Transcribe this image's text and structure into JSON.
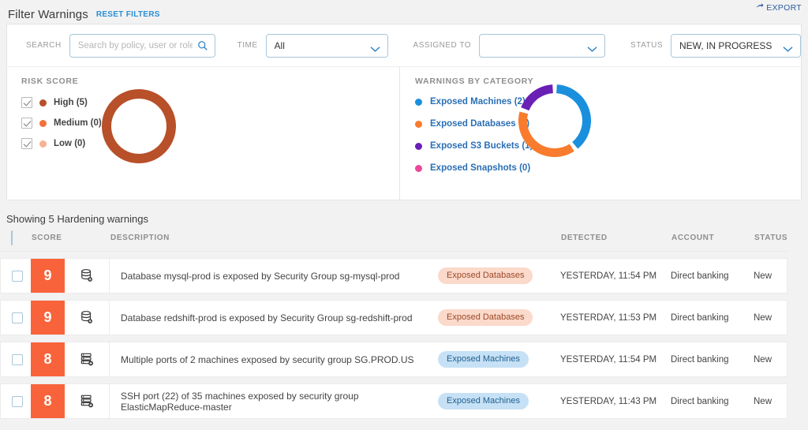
{
  "header": {
    "title": "Filter Warnings",
    "reset_label": "RESET FILTERS",
    "export_label": "EXPORT",
    "export_icon": "share-arrow-icon",
    "accent_link": "#2a8fd4"
  },
  "filters": {
    "search": {
      "label": "SEARCH",
      "placeholder": "Search by policy, user or role",
      "value": "",
      "icon": "search-icon"
    },
    "time": {
      "label": "TIME",
      "value": "All"
    },
    "assigned_to": {
      "label": "ASSIGNED TO",
      "value": ""
    },
    "status": {
      "label": "STATUS",
      "value": "NEW, IN PROGRESS"
    }
  },
  "risk_score": {
    "title": "RISK SCORE",
    "items": [
      {
        "label": "High (5)",
        "checked": true,
        "color": "#b8502a"
      },
      {
        "label": "Medium (0)",
        "checked": true,
        "color": "#f2703c"
      },
      {
        "label": "Low (0)",
        "checked": true,
        "color": "#f8b193"
      }
    ]
  },
  "warnings_by_category": {
    "title": "WARNINGS BY CATEGORY",
    "items": [
      {
        "label": "Exposed Machines (2)",
        "color": "#1a8fdd",
        "value": 2
      },
      {
        "label": "Exposed Databases (2)",
        "color": "#f97b2d",
        "value": 2
      },
      {
        "label": "Exposed S3 Buckets (1)",
        "color": "#6a1fb5",
        "value": 1
      },
      {
        "label": "Exposed Snapshots (0)",
        "color": "#ec4899",
        "value": 0
      }
    ]
  },
  "chart_data": [
    {
      "type": "pie",
      "title": "RISK SCORE",
      "categories": [
        "High",
        "Medium",
        "Low"
      ],
      "values": [
        5,
        0,
        0
      ],
      "colors": [
        "#b8502a",
        "#f2703c",
        "#f8b193"
      ],
      "legend": "left",
      "donut": true
    },
    {
      "type": "pie",
      "title": "WARNINGS BY CATEGORY",
      "categories": [
        "Exposed Machines",
        "Exposed Databases",
        "Exposed S3 Buckets",
        "Exposed Snapshots"
      ],
      "values": [
        2,
        2,
        1,
        0
      ],
      "colors": [
        "#1a8fdd",
        "#f97b2d",
        "#6a1fb5",
        "#ec4899"
      ],
      "legend": "left",
      "donut": true
    }
  ],
  "table": {
    "showing": "Showing 5 Hardening warnings",
    "columns": {
      "score": "SCORE",
      "description": "DESCRIPTION",
      "detected": "DETECTED",
      "account": "ACCOUNT",
      "status": "STATUS"
    },
    "rows": [
      {
        "score": "9",
        "icon": "database-icon",
        "description": "Database mysql-prod is exposed by Security Group sg-mysql-prod",
        "tag": "Exposed Databases",
        "tag_type": "databases",
        "detected": "YESTERDAY, 11:54 PM",
        "account": "Direct banking",
        "status": "New"
      },
      {
        "score": "9",
        "icon": "database-icon",
        "description": "Database redshift-prod is exposed by Security Group sg-redshift-prod",
        "tag": "Exposed Databases",
        "tag_type": "databases",
        "detected": "YESTERDAY, 11:53 PM",
        "account": "Direct banking",
        "status": "New"
      },
      {
        "score": "8",
        "icon": "server-stack-icon",
        "description": "Multiple ports of 2 machines exposed by security group SG.PROD.US",
        "tag": "Exposed Machines",
        "tag_type": "machines",
        "detected": "YESTERDAY, 11:54 PM",
        "account": "Direct banking",
        "status": "New"
      },
      {
        "score": "8",
        "icon": "server-stack-icon",
        "description": "SSH port (22) of 35 machines exposed by security group ElasticMapReduce-master",
        "tag": "Exposed Machines",
        "tag_type": "machines",
        "detected": "YESTERDAY, 11:43 PM",
        "account": "Direct banking",
        "status": "New"
      }
    ]
  }
}
